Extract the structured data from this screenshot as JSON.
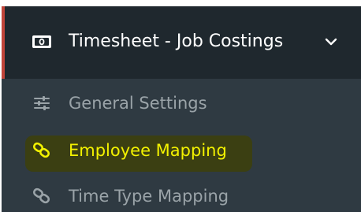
{
  "menu": {
    "header": {
      "icon": "money-icon",
      "title": "Timesheet - Job Costings",
      "chevron": "chevron-down-icon"
    },
    "items": [
      {
        "label": "General Settings",
        "icon": "sliders-icon",
        "state": "muted"
      },
      {
        "label": "Employee Mapping",
        "icon": "link-icon",
        "state": "active"
      },
      {
        "label": "Time Type Mapping",
        "icon": "link-icon",
        "state": "muted"
      }
    ]
  },
  "colors": {
    "panel_bg": "#2f3a42",
    "header_bg": "#1f282e",
    "accent": "#c2453a",
    "active_text": "#f3f200",
    "muted_text": "#9aa3a8"
  }
}
